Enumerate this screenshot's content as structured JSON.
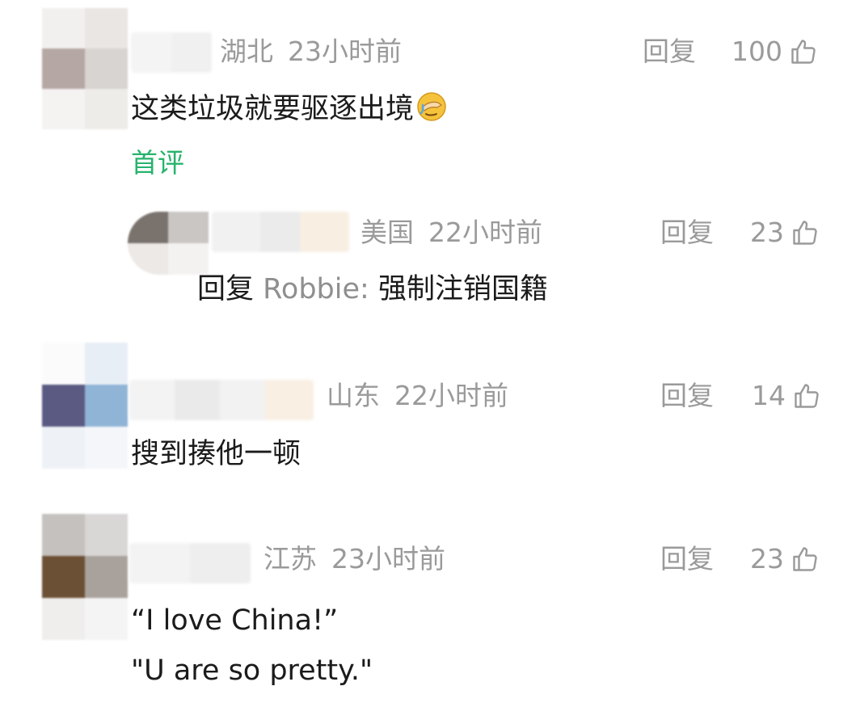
{
  "comments": [
    {
      "location": "湖北",
      "time": "23小时前",
      "reply_label": "回复",
      "likes": "100",
      "text": "这类垃圾就要驱逐出境",
      "emoji": "face-palm-emoji",
      "tag": "首评"
    },
    {
      "location": "美国",
      "time": "22小时前",
      "reply_label": "回复",
      "likes": "23",
      "reply_prefix": "回复",
      "reply_to": "Robbie:",
      "text": "强制注销国籍"
    },
    {
      "location": "山东",
      "time": "22小时前",
      "reply_label": "回复",
      "likes": "14",
      "text": "搜到揍他一顿"
    },
    {
      "location": "江苏",
      "time": "23小时前",
      "reply_label": "回复",
      "likes": "23",
      "text_line1": "“I love China!”",
      "text_line2": "\"U are so pretty.\""
    }
  ],
  "icons": {
    "like": "thumbs-up-outline-icon"
  },
  "colors": {
    "meta_gray": "#9a9a9a",
    "text": "#1b1b1b",
    "first_tag_green": "#27b36d"
  }
}
